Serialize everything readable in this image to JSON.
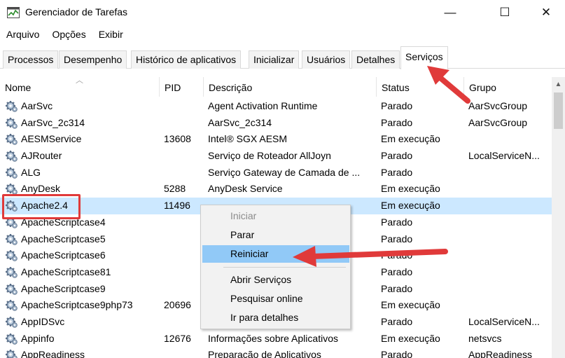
{
  "window": {
    "title": "Gerenciador de Tarefas",
    "controls": {
      "minimize": "—",
      "maximize": "☐",
      "close": "✕"
    }
  },
  "menu": [
    "Arquivo",
    "Opções",
    "Exibir"
  ],
  "tabs": [
    "Processos",
    "Desempenho",
    "Histórico de aplicativos",
    "Inicializar",
    "Usuários",
    "Detalhes",
    "Serviços"
  ],
  "active_tab": "Serviços",
  "columns": {
    "name": "Nome",
    "pid": "PID",
    "desc": "Descrição",
    "status": "Status",
    "group": "Grupo"
  },
  "services": [
    {
      "name": "AarSvc",
      "pid": "",
      "desc": "Agent Activation Runtime",
      "status": "Parado",
      "group": "AarSvcGroup"
    },
    {
      "name": "AarSvc_2c314",
      "pid": "",
      "desc": "AarSvc_2c314",
      "status": "Parado",
      "group": "AarSvcGroup"
    },
    {
      "name": "AESMService",
      "pid": "13608",
      "desc": "Intel® SGX AESM",
      "status": "Em execução",
      "group": ""
    },
    {
      "name": "AJRouter",
      "pid": "",
      "desc": "Serviço de Roteador AllJoyn",
      "status": "Parado",
      "group": "LocalServiceN..."
    },
    {
      "name": "ALG",
      "pid": "",
      "desc": "Serviço Gateway de Camada de ...",
      "status": "Parado",
      "group": ""
    },
    {
      "name": "AnyDesk",
      "pid": "5288",
      "desc": "AnyDesk Service",
      "status": "Em execução",
      "group": ""
    },
    {
      "name": "Apache2.4",
      "pid": "11496",
      "desc": "",
      "status": "Em execução",
      "group": ""
    },
    {
      "name": "ApacheScriptcase4",
      "pid": "",
      "desc": "",
      "status": "Parado",
      "group": ""
    },
    {
      "name": "ApacheScriptcase5",
      "pid": "",
      "desc": "",
      "status": "Parado",
      "group": ""
    },
    {
      "name": "ApacheScriptcase6",
      "pid": "",
      "desc": "",
      "status": "Parado",
      "group": ""
    },
    {
      "name": "ApacheScriptcase81",
      "pid": "",
      "desc": "",
      "status": "Parado",
      "group": ""
    },
    {
      "name": "ApacheScriptcase9",
      "pid": "",
      "desc": "",
      "status": "Parado",
      "group": ""
    },
    {
      "name": "ApacheScriptcase9php73",
      "pid": "20696",
      "desc": "",
      "status": "Em execução",
      "group": ""
    },
    {
      "name": "AppIDSvc",
      "pid": "",
      "desc": "",
      "status": "Parado",
      "group": "LocalServiceN..."
    },
    {
      "name": "Appinfo",
      "pid": "12676",
      "desc": "Informações sobre Aplicativos",
      "status": "Em execução",
      "group": "netsvcs"
    },
    {
      "name": "AppReadiness",
      "pid": "",
      "desc": "Preparação de Aplicativos",
      "status": "Parado",
      "group": "AppReadiness"
    }
  ],
  "selected_service": "Apache2.4",
  "context_menu": {
    "start": "Iniciar",
    "stop": "Parar",
    "restart": "Reiniciar",
    "open_services": "Abrir Serviços",
    "search_online": "Pesquisar online",
    "go_to_details": "Ir para detalhes"
  },
  "icons": {
    "app": "task-manager-icon",
    "service": "gear-icon"
  },
  "colors": {
    "selection": "#cce8ff",
    "menu_hover": "#91c9f7",
    "annotation": "#e03a3a"
  }
}
